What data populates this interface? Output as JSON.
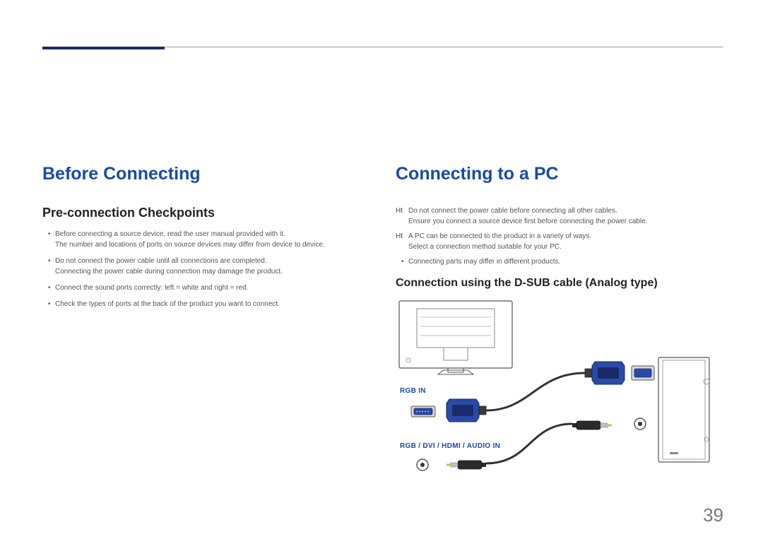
{
  "left": {
    "heading": "Before Connecting",
    "subheading": "Pre-connection Checkpoints",
    "bullets": [
      "Before connecting a source device, read the user manual provided with it.\nThe number and locations of ports on source devices may differ from device to device.",
      "Do not connect the power cable until all connections are completed.\nConnecting the power cable during connection may damage the product.",
      "Connect the sound ports correctly: left = white and right = red.",
      "Check the types of ports at the back of the product you want to connect."
    ]
  },
  "right": {
    "heading": "Connecting to a PC",
    "notes": [
      {
        "label": "Ht",
        "text": "Do not connect the power cable before connecting all other cables.\nEnsure you connect a source device first before connecting the power cable."
      },
      {
        "label": "Ht",
        "text": "A PC can be connected to the product in a variety of ways.\nSelect a connection method suitable for your PC."
      }
    ],
    "bullet": "Connecting parts may differ in different products.",
    "subheading": "Connection using the D-SUB cable (Analog type)",
    "port_label_1": "RGB IN",
    "port_label_2": "RGB / DVI / HDMI / AUDIO IN"
  },
  "page_number": "39"
}
